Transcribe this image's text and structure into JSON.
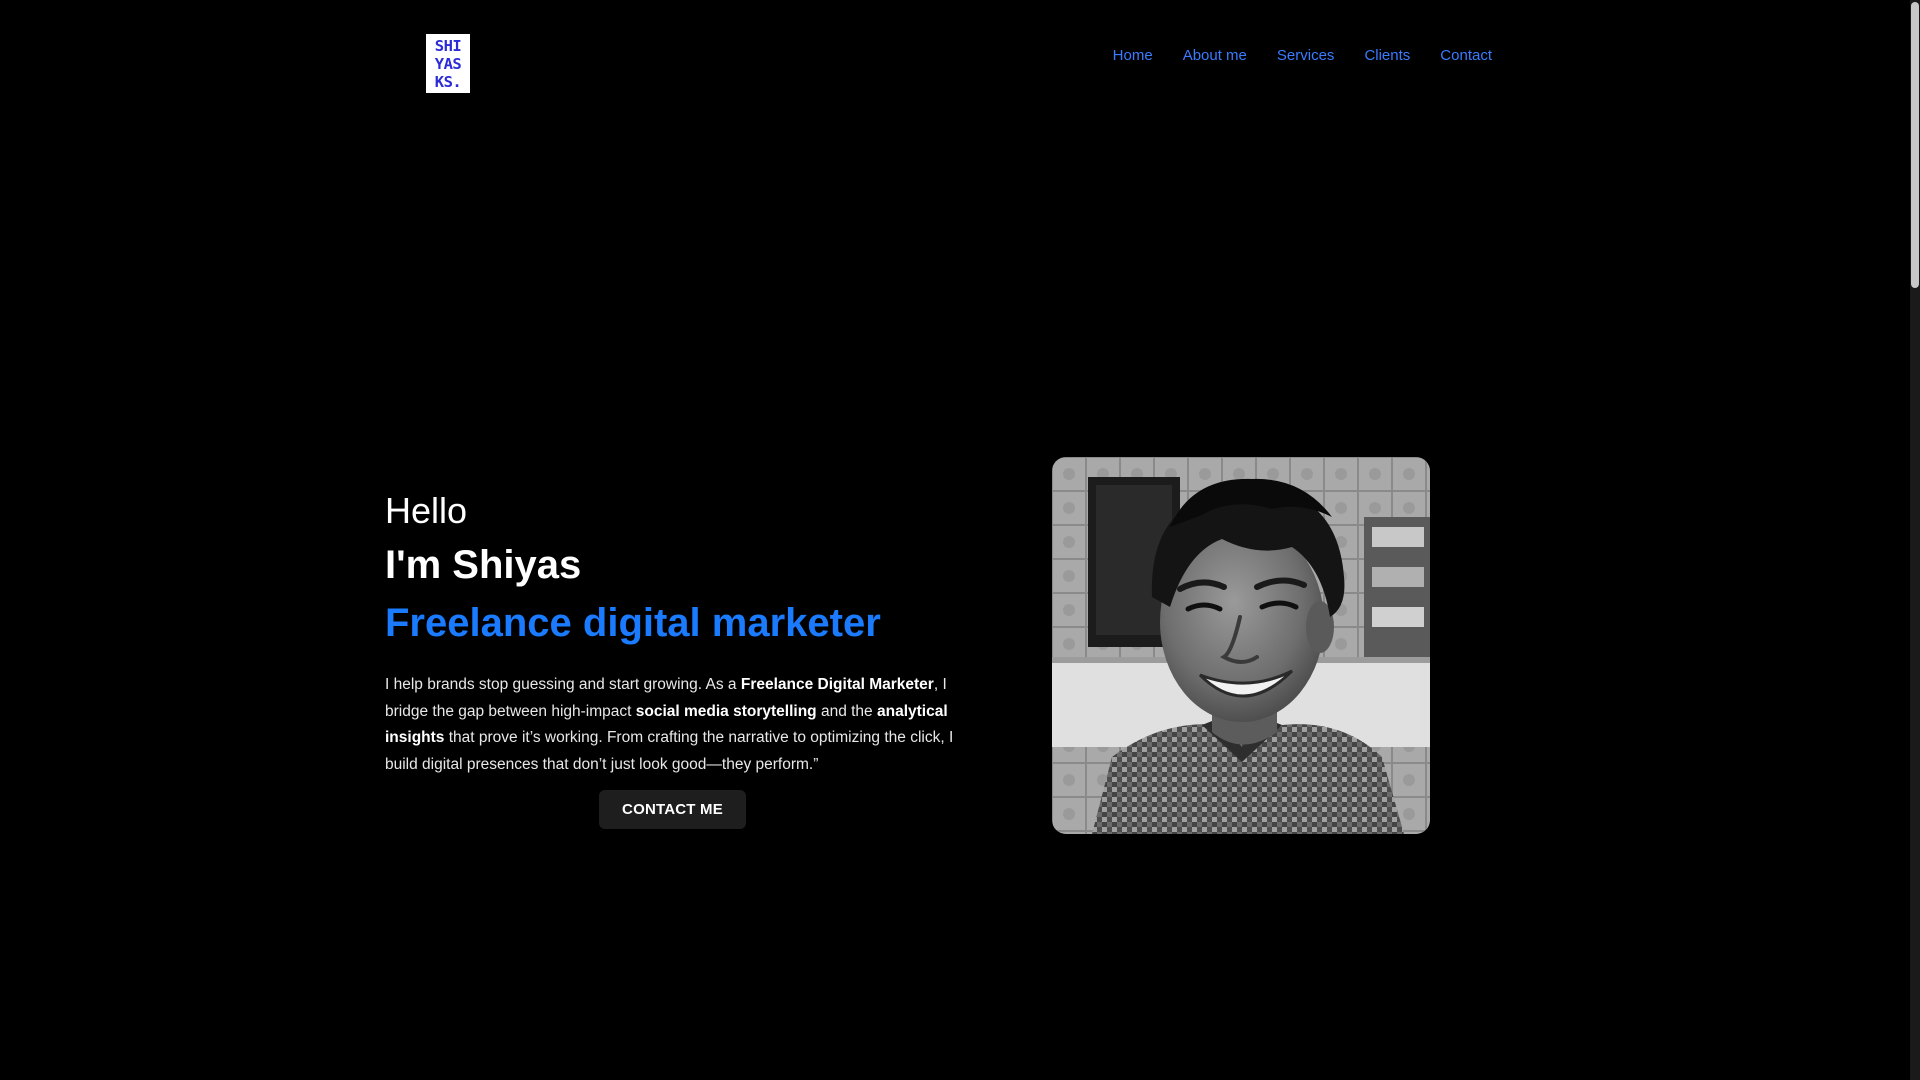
{
  "header": {
    "logo_lines": [
      "SHI",
      "YAS",
      "KS."
    ],
    "nav": [
      "Home",
      "About me",
      "Services",
      "Clients",
      "Contact"
    ]
  },
  "hero": {
    "greeting": "Hello",
    "name": "I'm Shiyas",
    "role": "Freelance digital marketer",
    "bio": {
      "t1": "I help brands stop guessing and start growing. As a ",
      "b1": "Freelance Digital Marketer",
      "t2": ", I bridge the gap between high-impact ",
      "b2": "social media storytelling",
      "t3": " and the ",
      "b3": "analytical insights",
      "t4": " that prove it’s working. From crafting the narrative to optimizing the click, I build digital presences that don’t just look good—they perform.”"
    },
    "cta_label": "CONTACT ME"
  },
  "colors": {
    "background": "#000000",
    "accent": "#1a7bff",
    "nav_link": "#3a7bff",
    "logo_text": "#2b2bd8",
    "button_bg": "#1e1e1e"
  },
  "icons": {
    "logo": "shiyasks-logo",
    "photo": "profile-photo"
  }
}
